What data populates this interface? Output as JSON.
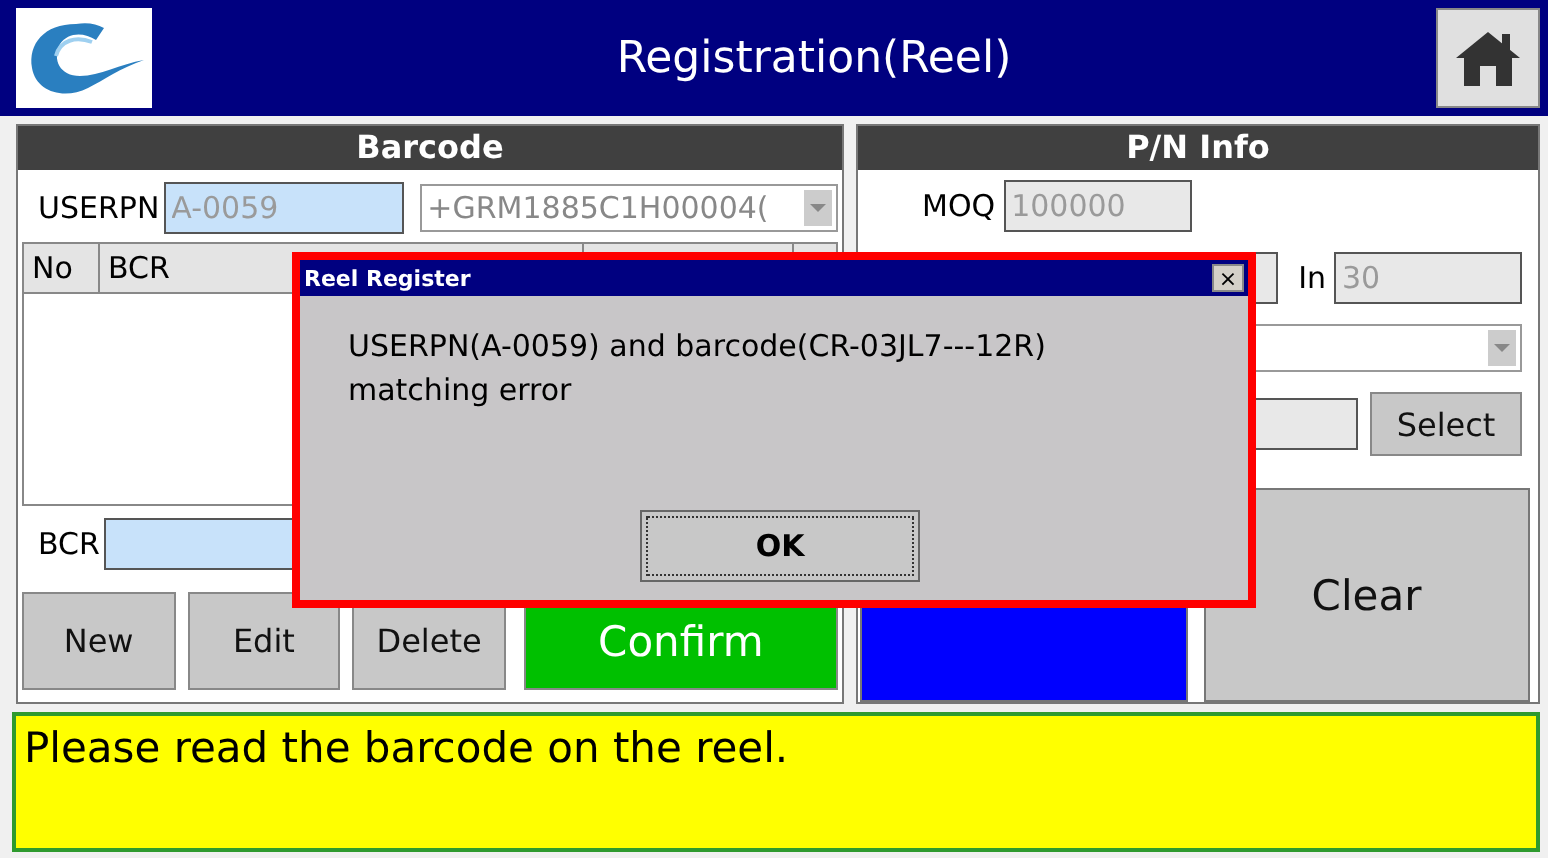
{
  "window": {
    "title": "Registration(Reel)"
  },
  "barcode_panel": {
    "title": "Barcode",
    "userpn_label": "USERPN",
    "userpn_value": "A-0059",
    "part_combo_value": "+GRM1885C1H00004(",
    "table": {
      "columns": [
        "No",
        "BCR",
        "",
        ""
      ]
    },
    "bcr_label": "BCR",
    "buttons": [
      {
        "label": "New",
        "kind": "normal"
      },
      {
        "label": "Edit",
        "kind": "normal"
      },
      {
        "label": "Delete",
        "kind": "normal"
      },
      {
        "label": "Confirm",
        "kind": "confirm"
      }
    ]
  },
  "pn_info_panel": {
    "title": "P/N Info",
    "moq_label": "MOQ",
    "moq_value": "100000",
    "in_label": "In",
    "in_value": "30",
    "select_button": "Select",
    "clear_button": "Clear"
  },
  "dialog": {
    "title": "Reel Register",
    "close": "×",
    "message": "USERPN(A-0059) and barcode(CR-03JL7---12R) matching error",
    "ok_button": "OK"
  },
  "status_message": "Please read the barcode on the reel."
}
